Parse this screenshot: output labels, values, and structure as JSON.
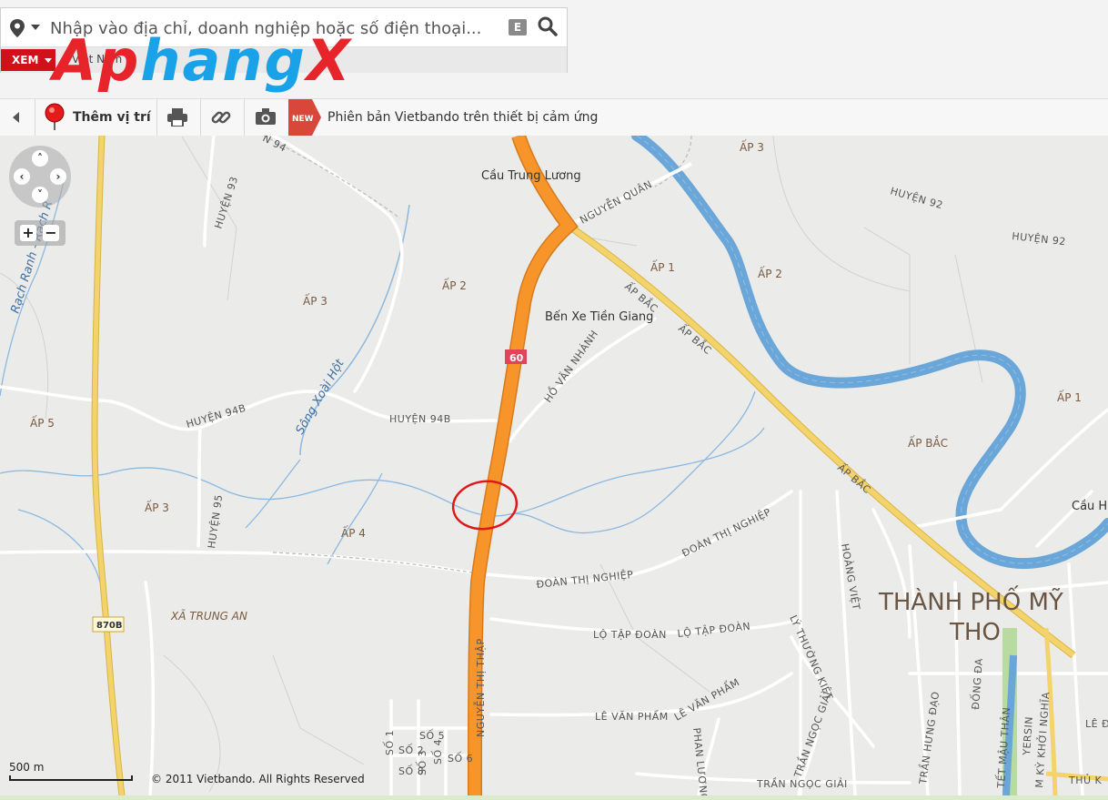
{
  "search": {
    "placeholder": "Nhập vào địa chỉ, doanh nghiệp hoặc số điện thoại...",
    "e_label": "E"
  },
  "view": {
    "button_label": "XEM",
    "country": "Việt Nam"
  },
  "logo": {
    "part1": "Ap",
    "part2": "hang",
    "part3": "X"
  },
  "toolbar": {
    "add_location": "Thêm vị trí",
    "new_badge": "NEW",
    "promo": "Phiên bản Vietbando trên thiết bị cảm ứng"
  },
  "map": {
    "roads": {
      "nguyen_thi_thap": "NGUYỄN THỊ THẬP",
      "ap_bac_1": "ẤP BẮC",
      "ap_bac_2": "ẤP BẮC",
      "ap_bac_3": "ẤP BẮC",
      "nguyen_quan": "NGUYỄN QUÂN",
      "huyen_92a": "HUYỆN 92",
      "huyen_92b": "HUYỆN 92",
      "huyen_94": "N 94",
      "huyen_93": "HUYỆN 93",
      "huyen_94b_1": "HUYỆN 94B",
      "huyen_94b_2": "HUYỆN 94B",
      "huyen_95": "HUYỆN 95",
      "ho_van_nhanh": "HỒ VĂN NHÁNH",
      "doan_thi_nghiep_1": "ĐOÀN THỊ NGHIỆP",
      "doan_thi_nghiep_2": "ĐOÀN THỊ NGHIỆP",
      "lo_tap_doan_1": "LỘ TẬP ĐOÀN",
      "lo_tap_doan_2": "LỘ TẬP ĐOÀN",
      "le_van_pham_1": "LÊ VĂN PHẨM",
      "le_van_pham_2": "LÊ VĂN PHẨM",
      "so5": "SỐ 5",
      "so1": "SỐ 1",
      "so2": "SỐ 2",
      "so3": "SỐ 3",
      "so4": "SỐ 4",
      "so6": "SỐ 6",
      "so8": "SỐ 8",
      "hoang_viet": "HOÀNG VIỆT",
      "ly_thuong_kiet": "LÝ THƯỜNG KIỆT",
      "phan_luong": "PHAN LƯƠNG",
      "tran_ngoc_giai": "TRẦN NGỌC GIẢI",
      "tran_hung_dao": "TRẦN HƯNG ĐẠO",
      "dong_da": "ĐỐNG ĐA",
      "tet_mau_than": "TẾT MẬU THÂN",
      "yersin": "YERSIN",
      "nam_ky_khoi_nghia": "M KỲ KHỞI NGHĨA",
      "le_d": "LÊ Đ",
      "thu_k": "THỦ K",
      "route_60": "60",
      "route_870b": "870B"
    },
    "places": {
      "ap3_top": "ẤP 3",
      "ap2_a": "ẤP 2",
      "ap3_b": "ẤP 3",
      "ap1_a": "ẤP 1",
      "ap2_b": "ẤP 2",
      "ap1_b": "ẤP 1",
      "ap5": "ẤP 5",
      "ap3_c": "ẤP 3",
      "ap4": "ẤP 4",
      "ap_bac": "ẤP BẮC",
      "xa_trung_an": "XÃ TRUNG AN",
      "cau_h": "Cầu H",
      "city_1": "THÀNH PHỐ MỸ",
      "city_2": "THO"
    },
    "pois": {
      "cau_trung_luong": "Cầu Trung Lương",
      "ben_xe": "Bến Xe Tiền Giang"
    },
    "water": {
      "song_xoai_hot": "Sông Xoài Hột",
      "rach_ranh": "Rạch Ranh - Rạch R"
    }
  },
  "controls": {
    "zoom_in": "+",
    "zoom_out": "−"
  },
  "scale": {
    "label": "500 m"
  },
  "copyright": "© 2011 Vietbando. All Rights Reserved",
  "colors": {
    "highway": "#f7942a",
    "secondary": "#f3d36a",
    "river": "#6aa6d8",
    "circle": "#e01818",
    "background": "#ebebea"
  }
}
